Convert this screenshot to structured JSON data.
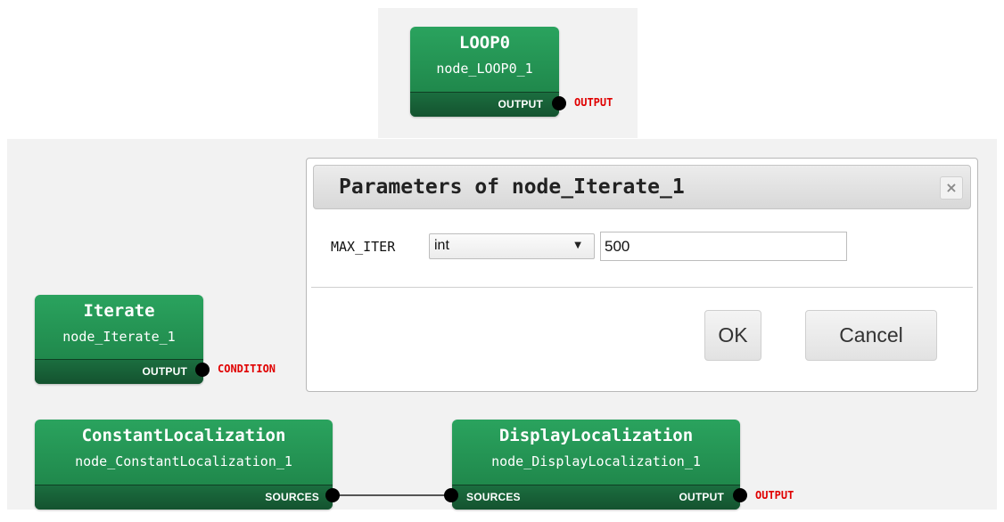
{
  "nodes": {
    "loop": {
      "title": "LOOP0",
      "id": "node_LOOP0_1",
      "out_port": "OUTPUT",
      "out_label": "OUTPUT"
    },
    "iterate": {
      "title": "Iterate",
      "id": "node_Iterate_1",
      "out_port": "OUTPUT",
      "out_label": "CONDITION"
    },
    "constant": {
      "title": "ConstantLocalization",
      "id": "node_ConstantLocalization_1",
      "out_port": "SOURCES"
    },
    "display": {
      "title": "DisplayLocalization",
      "id": "node_DisplayLocalization_1",
      "in_port": "SOURCES",
      "out_port": "OUTPUT",
      "out_label": "OUTPUT"
    }
  },
  "dialog": {
    "title": "Parameters of node_Iterate_1",
    "close_label": "×",
    "param": {
      "name": "MAX_ITER",
      "type": "int",
      "value": "500"
    },
    "ok_label": "OK",
    "cancel_label": "Cancel"
  },
  "icons": {
    "close": "close-icon",
    "select_arrow": "caret-down-icon"
  },
  "colors": {
    "node_green": "#1f8a4c",
    "output_red": "#e00000"
  }
}
